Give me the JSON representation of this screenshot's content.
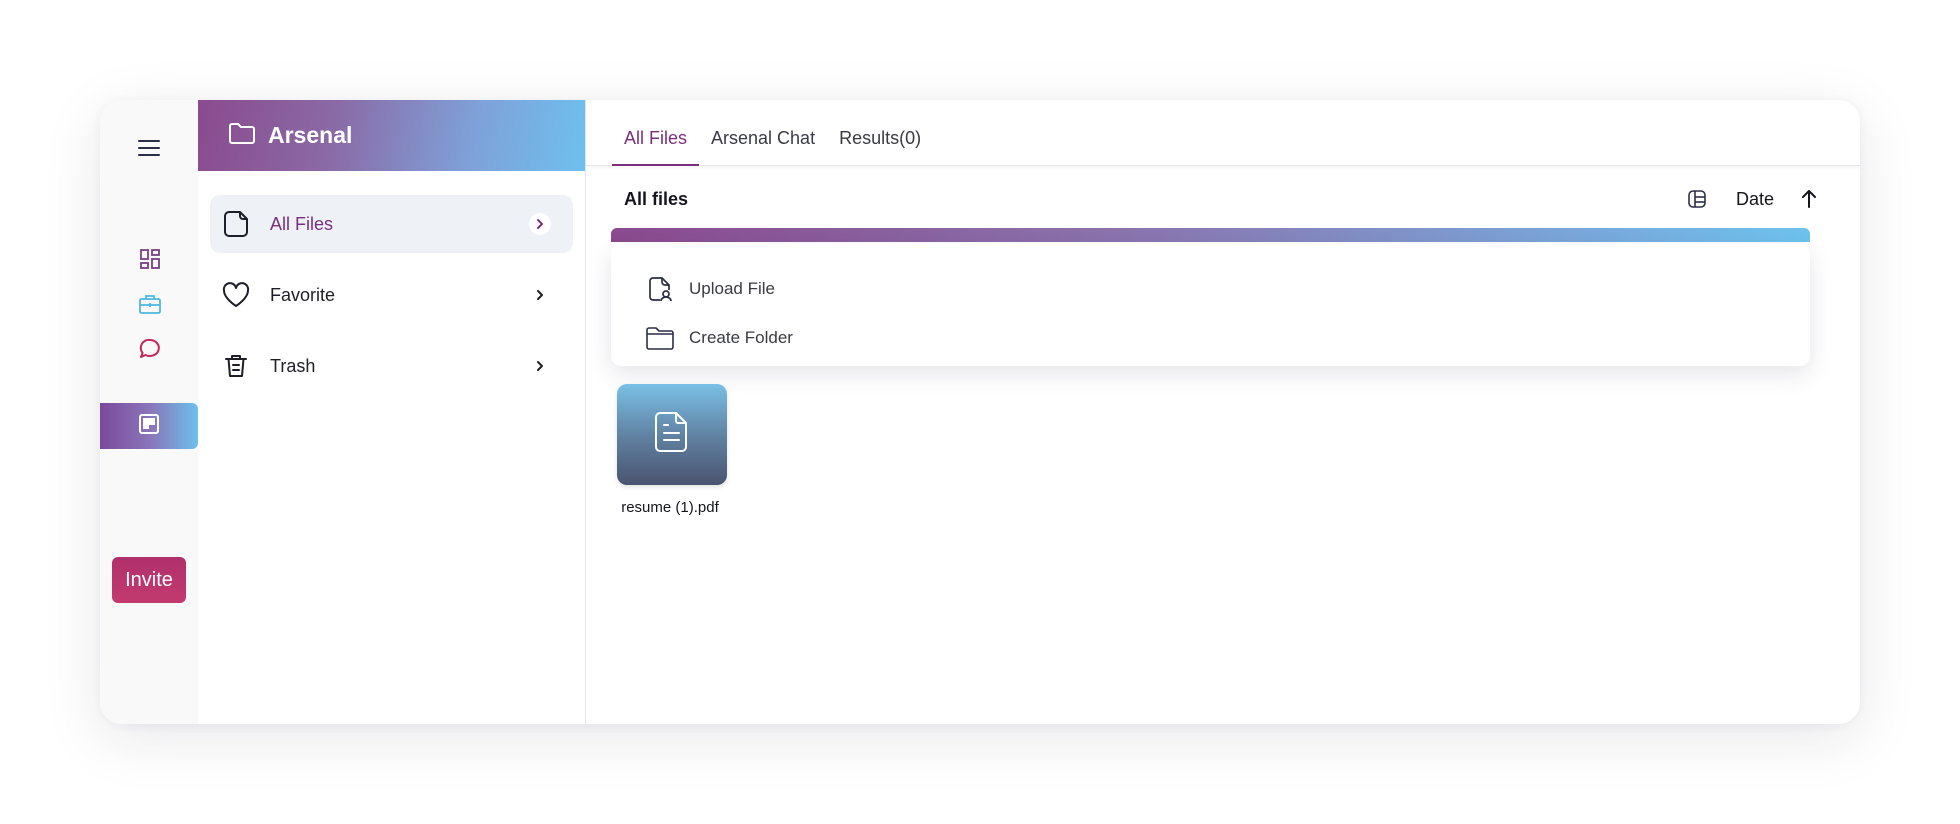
{
  "rail": {
    "menu_icon": "hamburger-menu-icon",
    "nav_icons": [
      "dashboard-icon",
      "briefcase-icon",
      "chat-icon",
      "board-icon"
    ],
    "invite_label": "Invite",
    "colors": {
      "dashboard": "#7a3f86",
      "briefcase": "#4fb8de",
      "chat": "#c2275c",
      "invite": "#b8326b"
    }
  },
  "folder_panel": {
    "title": "Arsenal",
    "title_icon": "folder-icon",
    "items": [
      {
        "label": "All Files",
        "icon": "file-icon",
        "active": true
      },
      {
        "label": "Favorite",
        "icon": "heart-icon",
        "active": false
      },
      {
        "label": "Trash",
        "icon": "trash-icon",
        "active": false
      }
    ]
  },
  "main": {
    "tabs": [
      {
        "label": "All Files",
        "active": true
      },
      {
        "label": "Arsenal Chat",
        "active": false
      },
      {
        "label": "Results(0)",
        "active": false
      }
    ],
    "heading": "All files",
    "sort_label": "Date",
    "sort_direction": "ascending",
    "dropdown": [
      {
        "label": "Upload File",
        "icon": "upload-file-icon"
      },
      {
        "label": "Create Folder",
        "icon": "folder-icon"
      }
    ],
    "files": [
      {
        "name": "resume (1).pdf",
        "icon": "document-icon"
      }
    ]
  },
  "colors": {
    "accent": "#7a2f7e",
    "gradient_start": "#8a4a8e",
    "gradient_end": "#6ec2ee"
  }
}
